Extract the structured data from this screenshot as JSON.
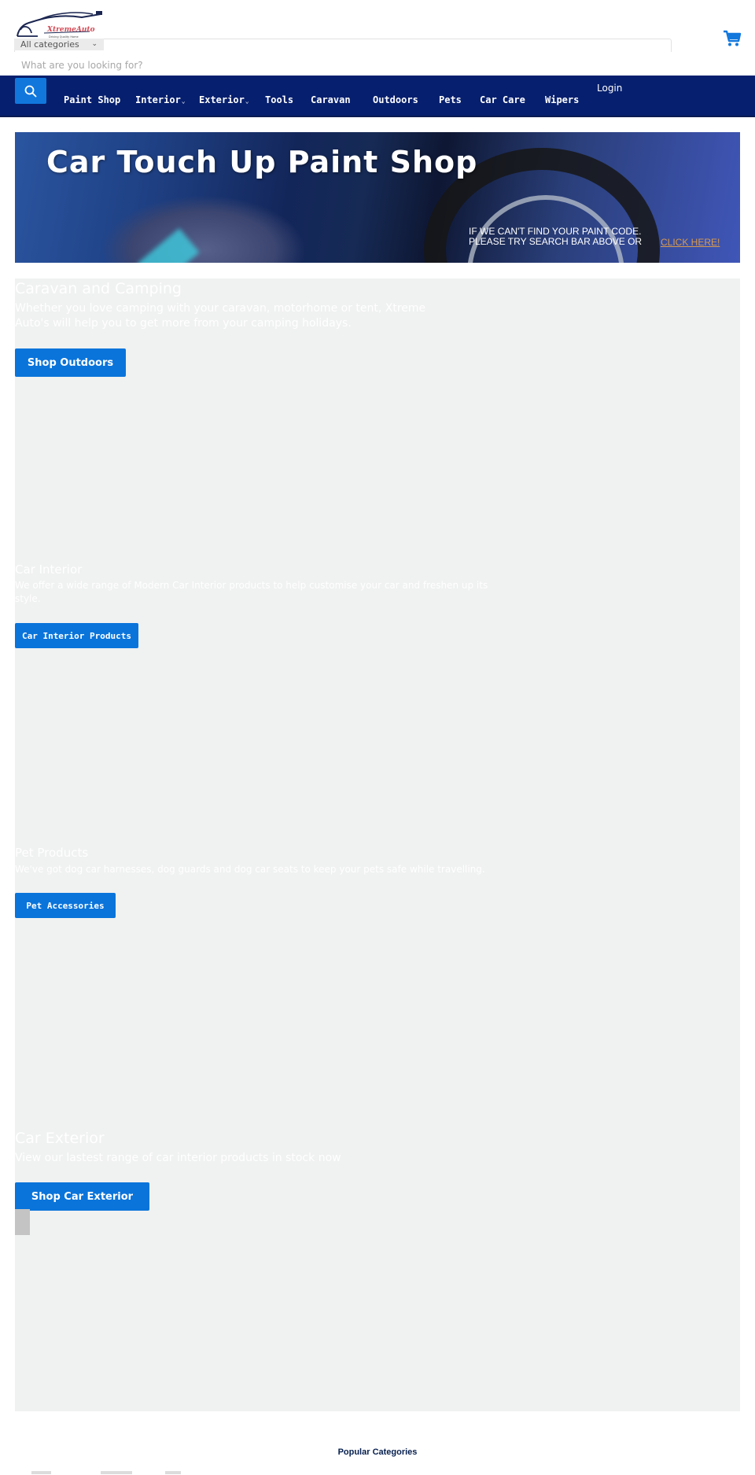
{
  "header": {
    "logo": {
      "brand": "XtremeAuto",
      "tagline": "Driving Quality Home",
      "icon": "car-logo-icon"
    },
    "category_select": {
      "selected": "All categories",
      "icon": "chevron-down-icon"
    },
    "search": {
      "placeholder": "What are you looking for?",
      "value": ""
    },
    "cart": {
      "icon": "shopping-cart-icon"
    }
  },
  "nav": {
    "search_button_icon": "search-icon",
    "items": [
      {
        "label": "Paint Shop",
        "has_dropdown": false
      },
      {
        "label": "Interior",
        "has_dropdown": true
      },
      {
        "label": "Exterior",
        "has_dropdown": true
      },
      {
        "label": "Tools",
        "has_dropdown": false
      },
      {
        "label": "Caravan",
        "has_dropdown": false
      },
      {
        "label": "Outdoors",
        "has_dropdown": false
      },
      {
        "label": "Pets",
        "has_dropdown": false
      },
      {
        "label": "Car Care",
        "has_dropdown": false
      },
      {
        "label": "Wipers",
        "has_dropdown": false
      }
    ],
    "caret": "⌄",
    "login": "Login"
  },
  "hero": {
    "title": "Car Touch Up Paint Shop",
    "note_line1": "IF WE CAN'T FIND YOUR PAINT CODE.",
    "note_line2": "PLEASE TRY SEARCH BAR ABOVE OR",
    "link": "CLICK HERE!"
  },
  "promos": [
    {
      "title": "Caravan and Camping",
      "description": "Whether you love camping with your caravan, motorhome or tent, Xtreme Auto's will help you to get more from your camping holidays.",
      "button": "Shop Outdoors"
    },
    {
      "title": "Car Interior",
      "description": "We offer a wide range of Modern Car Interior products to help customise your car and freshen up its style.",
      "button": "Car Interior Products"
    },
    {
      "title": "Pet Products",
      "description": "We've got dog car harnesses, dog guards and dog car seats to keep your pets safe while travelling.",
      "button": "Pet Accessories"
    },
    {
      "title": "Car Exterior",
      "description": "View our lastest range of car interior products in stock now",
      "button": "Shop Car Exterior"
    }
  ],
  "footer": {
    "popular_heading": "Popular Categories"
  },
  "colors": {
    "nav_bg": "#061f6e",
    "accent_blue": "#0a74da",
    "promo_bg": "#f0f1f1",
    "link_orange": "#d89a4f"
  }
}
